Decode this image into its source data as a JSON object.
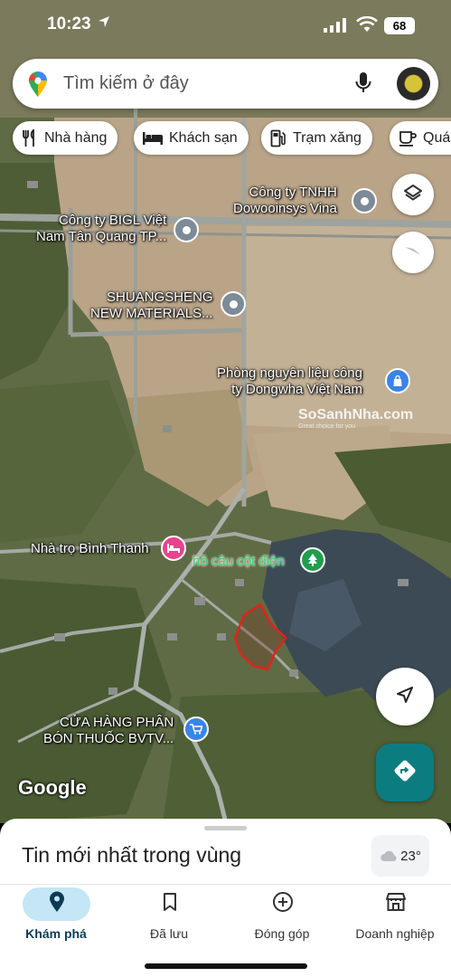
{
  "status_bar": {
    "time": "10:23",
    "battery": "68"
  },
  "search": {
    "placeholder": "Tìm kiếm ở đây"
  },
  "chips": [
    {
      "label": "Nhà hàng",
      "icon": "fork-knife-icon"
    },
    {
      "label": "Khách sạn",
      "icon": "bed-icon"
    },
    {
      "label": "Trạm xăng",
      "icon": "gas-pump-icon"
    },
    {
      "label": "Quán",
      "icon": "coffee-cup-icon"
    }
  ],
  "map": {
    "pois": [
      {
        "name": "Công ty TNHH\nDowooinsys Vina",
        "icon": "place-pin-icon"
      },
      {
        "name": "Công ty BIGL Việt\nNam Tân Quang TP...",
        "icon": "place-pin-icon"
      },
      {
        "name": "SHUANGSHENG\nNEW MATERIALS...",
        "icon": "place-pin-icon"
      },
      {
        "name": "Phòng nguyên liệu công\nty Dongwha Việt Nam",
        "icon": "shopping-bag-icon"
      },
      {
        "name": "Nhà trọ Bình Thanh",
        "icon": "bed-icon"
      },
      {
        "name": "hồ câu cột điện",
        "icon": "tree-icon"
      },
      {
        "name": "CỬA HÀNG PHÂN\nBÓN THUỐC BVTV...",
        "icon": "shopping-cart-icon"
      }
    ],
    "watermark": "SoSanhNha.com",
    "watermark_sub": "Great choice for you",
    "attribution": "Google"
  },
  "sheet": {
    "title": "Tin mới nhất trong vùng",
    "temperature": "23°"
  },
  "nav": [
    {
      "label": "Khám phá",
      "icon": "explore-pin-icon",
      "active": true
    },
    {
      "label": "Đã lưu",
      "icon": "bookmark-icon",
      "active": false
    },
    {
      "label": "Đóng góp",
      "icon": "add-circle-icon",
      "active": false
    },
    {
      "label": "Doanh nghiệp",
      "icon": "storefront-icon",
      "active": false
    }
  ],
  "colors": {
    "directions_button": "#0b7d80",
    "active_nav_pill": "#c4e6f5",
    "drawn_outline": "#e0241b"
  }
}
